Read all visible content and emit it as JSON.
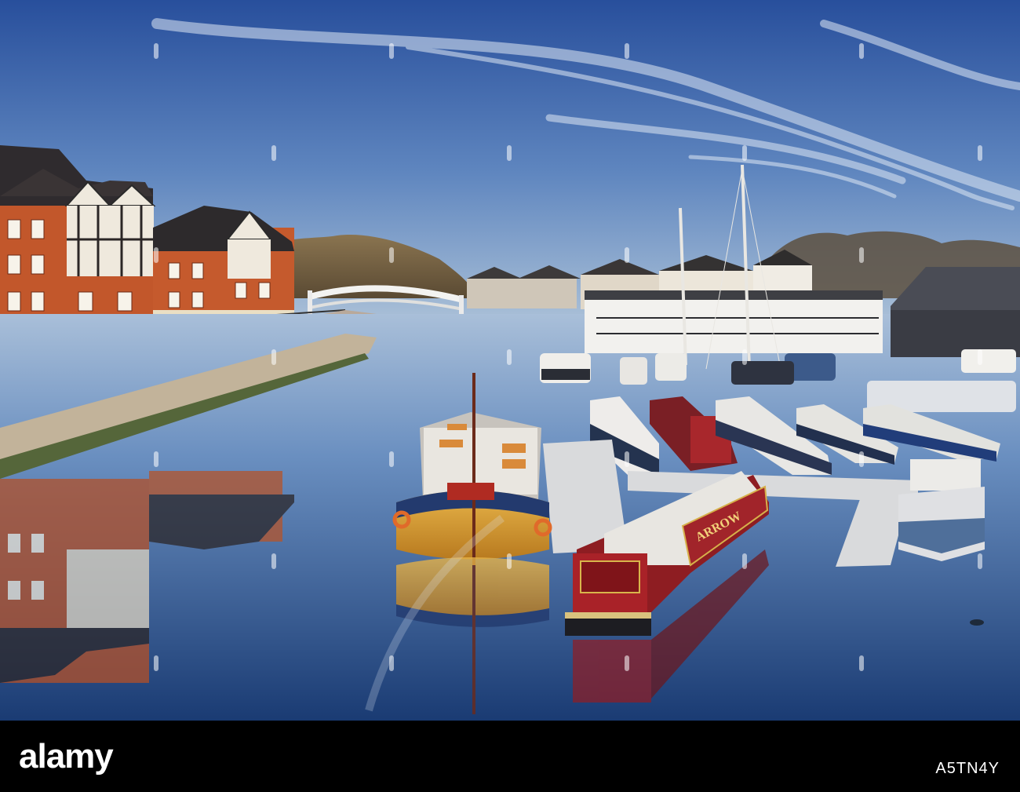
{
  "image": {
    "scene": "canal marina with narrowboats",
    "colors": {
      "sky_top": "#2f5aa8",
      "sky_bottom": "#9ab5d3",
      "water_top": "#8aa8cc",
      "water_bottom": "#1c3f7a",
      "brick": "#c2572b",
      "footer": "#000000"
    }
  },
  "footer": {
    "logo_text": "alamy",
    "stock_id": "A5TN4Y"
  },
  "boat_name": "ARROW"
}
